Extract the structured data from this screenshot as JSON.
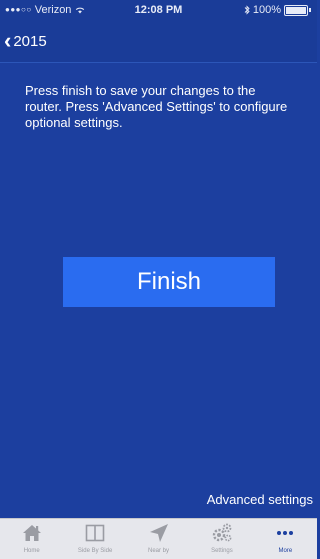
{
  "status_bar": {
    "carrier": "Verizon",
    "time": "12:08 PM",
    "battery": "100%",
    "signal_dots": "●●●○○"
  },
  "nav": {
    "back_label": "2015"
  },
  "main": {
    "instructions": "Press finish to save your changes to the router. Press 'Advanced Settings' to configure optional settings.",
    "finish_label": "Finish",
    "advanced_label": "Advanced settings"
  },
  "tab_bar": {
    "tabs": [
      {
        "label": "Home",
        "icon": "home-icon"
      },
      {
        "label": "Side By Side",
        "icon": "columns-icon"
      },
      {
        "label": "Near by",
        "icon": "location-arrow-icon"
      },
      {
        "label": "Settings",
        "icon": "gears-icon"
      },
      {
        "label": "More",
        "icon": "more-dots-icon"
      }
    ]
  },
  "colors": {
    "background": "#1c3f9f",
    "finish_button": "#2a6cf0",
    "tab_bar": "#e6e7ec",
    "tab_inactive": "#9a9ca3",
    "tab_active": "#1c3f9f"
  }
}
